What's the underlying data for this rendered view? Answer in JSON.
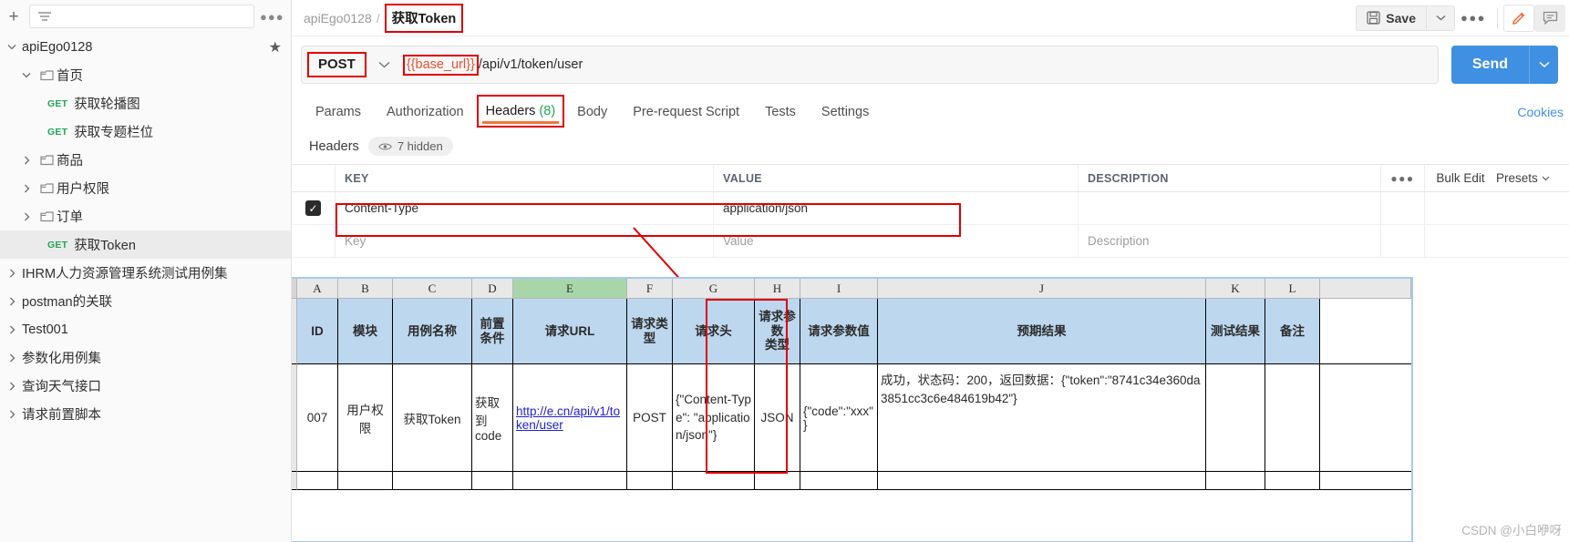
{
  "sidebar": {
    "filter_placeholder": "",
    "more_icon": "more-horizontal-icon",
    "items": [
      {
        "label": "apiEgo0128",
        "type": "collection",
        "indent": 0,
        "expanded": true,
        "starred": true
      },
      {
        "label": "首页",
        "type": "folder",
        "indent": 1,
        "expanded": true
      },
      {
        "label": "获取轮播图",
        "type": "request",
        "method": "GET",
        "indent": 2
      },
      {
        "label": "获取专题栏位",
        "type": "request",
        "method": "GET",
        "indent": 2
      },
      {
        "label": "商品",
        "type": "folder",
        "indent": 1,
        "expanded": false
      },
      {
        "label": "用户权限",
        "type": "folder",
        "indent": 1,
        "expanded": false
      },
      {
        "label": "订单",
        "type": "folder",
        "indent": 1,
        "expanded": false
      },
      {
        "label": "获取Token",
        "type": "request",
        "method": "GET",
        "indent": 2,
        "selected": true
      },
      {
        "label": "IHRM人力资源管理系统测试用例集",
        "type": "collection",
        "indent": 0,
        "expanded": false
      },
      {
        "label": "postman的关联",
        "type": "collection",
        "indent": 0,
        "expanded": false
      },
      {
        "label": "Test001",
        "type": "collection",
        "indent": 0,
        "expanded": false
      },
      {
        "label": "参数化用例集",
        "type": "collection",
        "indent": 0,
        "expanded": false
      },
      {
        "label": "查询天气接口",
        "type": "collection",
        "indent": 0,
        "expanded": false
      },
      {
        "label": "请求前置脚本",
        "type": "collection",
        "indent": 0,
        "expanded": false
      }
    ]
  },
  "topbar": {
    "breadcrumb_collection": "apiEgo0128",
    "breadcrumb_sep": "/",
    "breadcrumb_current": "获取Token",
    "save_label": "Save",
    "save_icon": "floppy-disk-icon",
    "save_caret_icon": "chevron-down-icon",
    "more_icon": "more-horizontal-icon",
    "edit_icon": "pencil-icon",
    "comment_icon": "comment-icon"
  },
  "request": {
    "method": "POST",
    "method_caret_icon": "chevron-down-icon",
    "url_variable": "{{base_url}}",
    "url_path": "/api/v1/token/user",
    "send_label": "Send",
    "send_caret_icon": "chevron-down-icon"
  },
  "tabs": {
    "items": [
      {
        "label": "Params",
        "active": false
      },
      {
        "label": "Authorization",
        "active": false
      },
      {
        "label": "Headers",
        "count": "(8)",
        "active": true
      },
      {
        "label": "Body",
        "active": false
      },
      {
        "label": "Pre-request Script",
        "active": false
      },
      {
        "label": "Tests",
        "active": false
      },
      {
        "label": "Settings",
        "active": false
      }
    ],
    "cookies_label": "Cookies"
  },
  "headers_panel": {
    "title": "Headers",
    "hidden_label": "7 hidden",
    "eye_icon": "eye-icon",
    "columns": {
      "key": "KEY",
      "value": "VALUE",
      "description": "DESCRIPTION"
    },
    "more_icon": "more-horizontal-icon",
    "bulk_edit_label": "Bulk Edit",
    "presets_label": "Presets",
    "presets_caret_icon": "chevron-down-icon",
    "rows": [
      {
        "checked": true,
        "key": "Content-Type",
        "value": "application/json",
        "description": ""
      }
    ],
    "placeholder_row": {
      "key": "Key",
      "value": "Value",
      "description": "Description"
    }
  },
  "spreadsheet": {
    "column_letters": [
      "A",
      "B",
      "C",
      "D",
      "E",
      "F",
      "G",
      "H",
      "I",
      "J",
      "K",
      "L"
    ],
    "selected_column": "E",
    "headers": [
      "ID",
      "模块",
      "用例名称",
      "前置\n条件",
      "请求URL",
      "请求类\n型",
      "请求头",
      "请求参\n数\n类型",
      "请求参数值",
      "预期结果",
      "测试结果",
      "备注"
    ],
    "rows": [
      {
        "id": "007",
        "module": "用户权限",
        "case_name": "获取Token",
        "precondition": "获取\n到\ncode",
        "url": "http://e.cn/api/v1/token/user",
        "req_type": "POST",
        "req_header": "{\"Content-Type\": \"application/json\"}",
        "param_type": "JSON",
        "param_value": "{\"code\":\"xxx\"\n}",
        "expected": "成功，状态码：200，返回数据：{\"token\":\"8741c34e360da3851cc3c6e484619b42\"}",
        "test_result": "",
        "remark": ""
      }
    ]
  },
  "watermark": "CSDN @小白咿呀",
  "colors": {
    "accent_blue": "#3f8fe3",
    "annotation_red": "#e00000",
    "method_green": "#23a559",
    "tab_underline": "#f2763b",
    "sheet_header_blue": "#bdd7ee",
    "selected_col_green": "#a9d6a9"
  }
}
